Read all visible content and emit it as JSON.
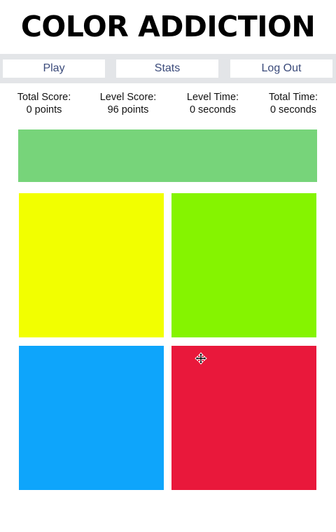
{
  "app": {
    "title": "COLOR ADDICTION"
  },
  "nav": {
    "play_label": "Play",
    "stats_label": "Stats",
    "logout_label": "Log Out"
  },
  "stats": {
    "total_score_label": "Total Score:",
    "total_score_value": "0 points",
    "level_score_label": "Level Score:",
    "level_score_value": "96 points",
    "level_time_label": "Level Time:",
    "level_time_value": "0 seconds",
    "total_time_label": "Total Time:",
    "total_time_value": "0 seconds"
  },
  "game": {
    "target_color": "#77d47a",
    "tiles": [
      {
        "color": "#f2ff00"
      },
      {
        "color": "#85f400"
      },
      {
        "color": "#0ea5fb"
      },
      {
        "color": "#e9183b"
      }
    ]
  },
  "cursor": {
    "icon": "move-cursor-icon"
  }
}
